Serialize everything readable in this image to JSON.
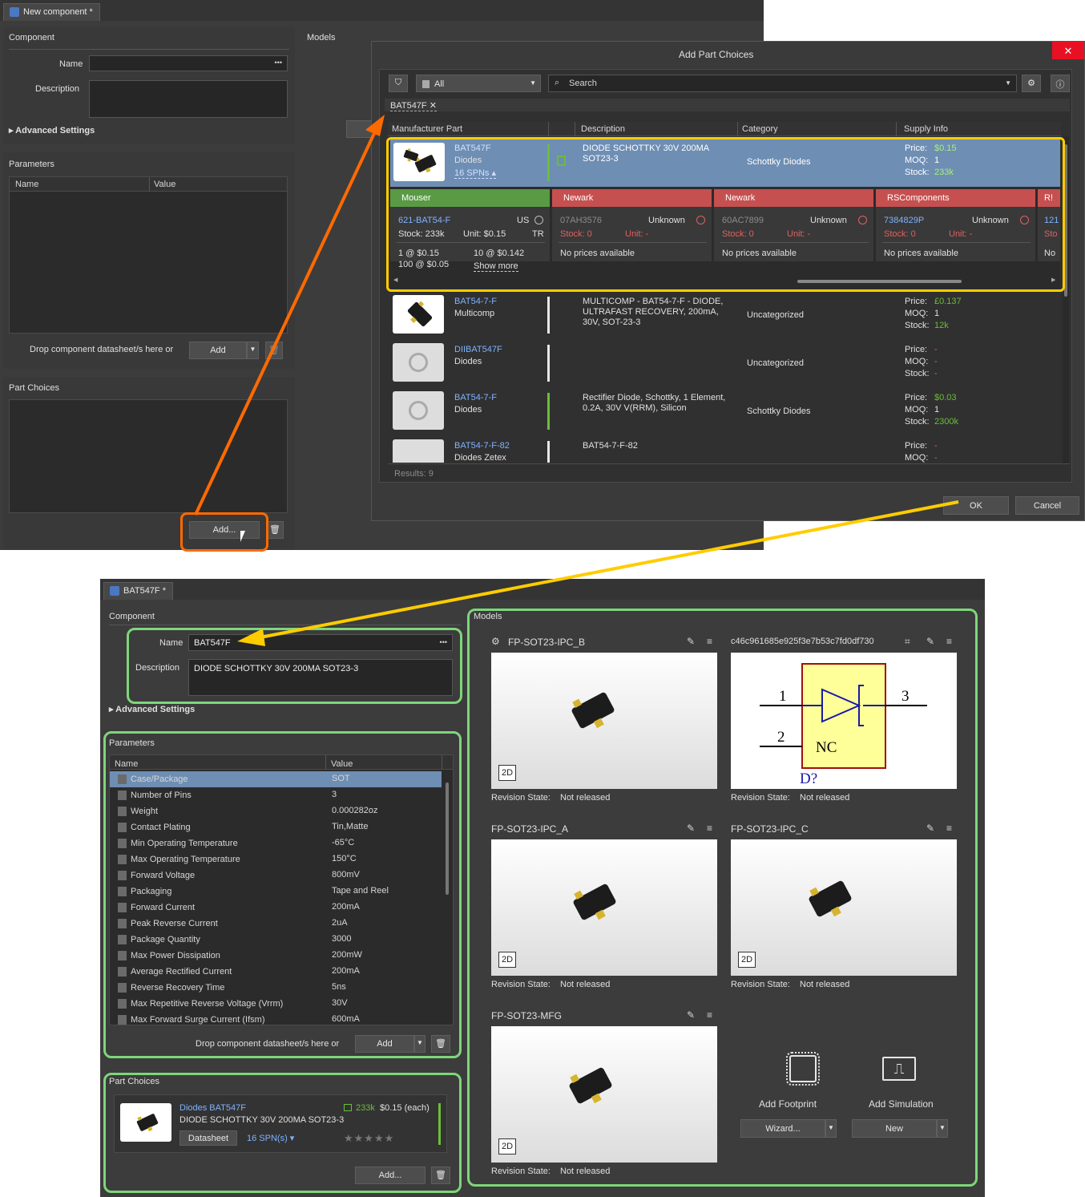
{
  "top": {
    "tab_title": "New component *",
    "component_header": "Component",
    "name_label": "Name",
    "name_dots": "•••",
    "description_label": "Description",
    "advanced_settings": "Advanced Settings",
    "models_header": "Models",
    "parameters_header": "Parameters",
    "param_col_name": "Name",
    "param_col_value": "Value",
    "drop_text": "Drop component datasheet/s here or",
    "add_label": "Add",
    "part_choices_header": "Part Choices",
    "add_dots_label": "Add..."
  },
  "dialog": {
    "title": "Add Part Choices",
    "close": "✕",
    "filter_value": "All",
    "search_placeholder": "Search",
    "search_tag": "BAT547F",
    "columns": [
      "Manufacturer Part",
      "Description",
      "Category",
      "Supply Info"
    ],
    "price_label": "Price:",
    "moq_label": "MOQ:",
    "stock_label": "Stock:",
    "selected": {
      "part": "BAT547F",
      "manufacturer": "Diodes",
      "spns": "16 SPNs ▴",
      "description": "DIODE SCHOTTKY 30V 200MA SOT23-3",
      "category": "Schottky Diodes",
      "price": "$0.15",
      "moq": "1",
      "stock": "233k"
    },
    "suppliers": [
      {
        "name": "Mouser",
        "color": "#5a9a45",
        "spn": "621-BAT54-F",
        "region": "US",
        "stock": "Stock: 233k",
        "unit": "Unit: $0.15",
        "pkg": "TR",
        "p1": "1 @ $0.15",
        "p2": "10 @ $0.142",
        "p3": "100 @ $0.05",
        "more": "Show more"
      },
      {
        "name": "Newark",
        "color": "#c65050",
        "spn": "07AH3576",
        "status": "Unknown",
        "stock": "Stock: 0",
        "unit": "Unit: -",
        "note": "No prices available"
      },
      {
        "name": "Newark",
        "color": "#c65050",
        "spn": "60AC7899",
        "status": "Unknown",
        "stock": "Stock: 0",
        "unit": "Unit: -",
        "note": "No prices available"
      },
      {
        "name": "RSComponents",
        "color": "#c65050",
        "spn": "7384829P",
        "status": "Unknown",
        "stock": "Stock: 0",
        "unit": "Unit: -",
        "note": "No prices available"
      },
      {
        "name": "R!",
        "spn": "121",
        "stock": "Sto",
        "note": "No"
      }
    ],
    "rows": [
      {
        "part": "BAT54-7-F",
        "manufacturer": "Multicomp",
        "description": "MULTICOMP - BAT54-7-F - DIODE, ULTRAFAST RECOVERY, 200mA, 30V, SOT-23-3",
        "category": "Uncategorized",
        "price": "£0.137",
        "moq": "1",
        "stock": "12k"
      },
      {
        "part": "DIIBAT547F",
        "manufacturer": "Diodes",
        "description": "",
        "category": "Uncategorized",
        "price": "-",
        "moq": "-",
        "stock": "-"
      },
      {
        "part": "BAT54-7-F",
        "manufacturer": "Diodes",
        "description": "Rectifier Diode, Schottky, 1 Element, 0.2A, 30V V(RRM), Silicon",
        "category": "Schottky Diodes",
        "price": "$0.03",
        "moq": "1",
        "stock": "2300k"
      },
      {
        "part": "BAT54-7-F-82",
        "manufacturer": "Diodes Zetex",
        "description": "BAT54-7-F-82",
        "category": "",
        "price": "-",
        "moq": "-",
        "stock": ""
      }
    ],
    "results": "Results: 9",
    "ok": "OK",
    "cancel": "Cancel"
  },
  "bottom": {
    "tab_title": "BAT547F *",
    "component_header": "Component",
    "name_label": "Name",
    "name_value": "BAT547F",
    "name_dots": "•••",
    "description_label": "Description",
    "description_value": "DIODE SCHOTTKY 30V 200MA SOT23-3",
    "advanced_settings": "Advanced Settings",
    "parameters_header": "Parameters",
    "param_col_name": "Name",
    "param_col_value": "Value",
    "parameters": [
      {
        "name": "Case/Package",
        "value": "SOT"
      },
      {
        "name": "Number of Pins",
        "value": "3"
      },
      {
        "name": "Weight",
        "value": "0.000282oz"
      },
      {
        "name": "Contact Plating",
        "value": "Tin,Matte"
      },
      {
        "name": "Min Operating Temperature",
        "value": "-65°C"
      },
      {
        "name": "Max Operating Temperature",
        "value": "150°C"
      },
      {
        "name": "Forward Voltage",
        "value": "800mV"
      },
      {
        "name": "Packaging",
        "value": "Tape and Reel"
      },
      {
        "name": "Forward Current",
        "value": "200mA"
      },
      {
        "name": "Peak Reverse Current",
        "value": "2uA"
      },
      {
        "name": "Package Quantity",
        "value": "3000"
      },
      {
        "name": "Max Power Dissipation",
        "value": "200mW"
      },
      {
        "name": "Average Rectified Current",
        "value": "200mA"
      },
      {
        "name": "Reverse Recovery Time",
        "value": "5ns"
      },
      {
        "name": "Max Repetitive Reverse Voltage (Vrrm)",
        "value": "30V"
      },
      {
        "name": "Max Forward Surge Current (Ifsm)",
        "value": "600mA"
      }
    ],
    "drop_text": "Drop component datasheet/s here or",
    "add_label": "Add",
    "part_choices_header": "Part Choices",
    "part_choice": {
      "title": "Diodes BAT547F",
      "description": "DIODE SCHOTTKY 30V 200MA SOT23-3",
      "stock": "233k",
      "price": "$0.15 (each)",
      "datasheet": "Datasheet",
      "spns": "16 SPN(s) ▾",
      "stars": "★★★★★"
    },
    "add_dots_label": "Add...",
    "models_header": "Models",
    "revision_label": "Revision State:",
    "revision_value": "Not released",
    "btn_2d": "2D",
    "models": [
      {
        "name": "FP-SOT23-IPC_B"
      },
      {
        "name": "c46c961685e925f3e7b53c7fd0df730"
      },
      {
        "name": "FP-SOT23-IPC_A"
      },
      {
        "name": "FP-SOT23-IPC_C"
      },
      {
        "name": "FP-SOT23-MFG"
      }
    ],
    "schematic": {
      "pin1": "1",
      "pin2": "2",
      "pin3": "3",
      "nc": "NC",
      "designator": "D?"
    },
    "add_footprint": "Add Footprint",
    "add_simulation": "Add Simulation",
    "wizard": "Wizard...",
    "new": "New"
  },
  "colors": {
    "background": "#3c3c3c",
    "accent_link": "#7fb2ff",
    "stock_green": "#6bbd3a",
    "highlight_yellow": "#ffcc00",
    "highlight_orange": "#ff6a00",
    "highlight_green": "#7ed67a"
  }
}
